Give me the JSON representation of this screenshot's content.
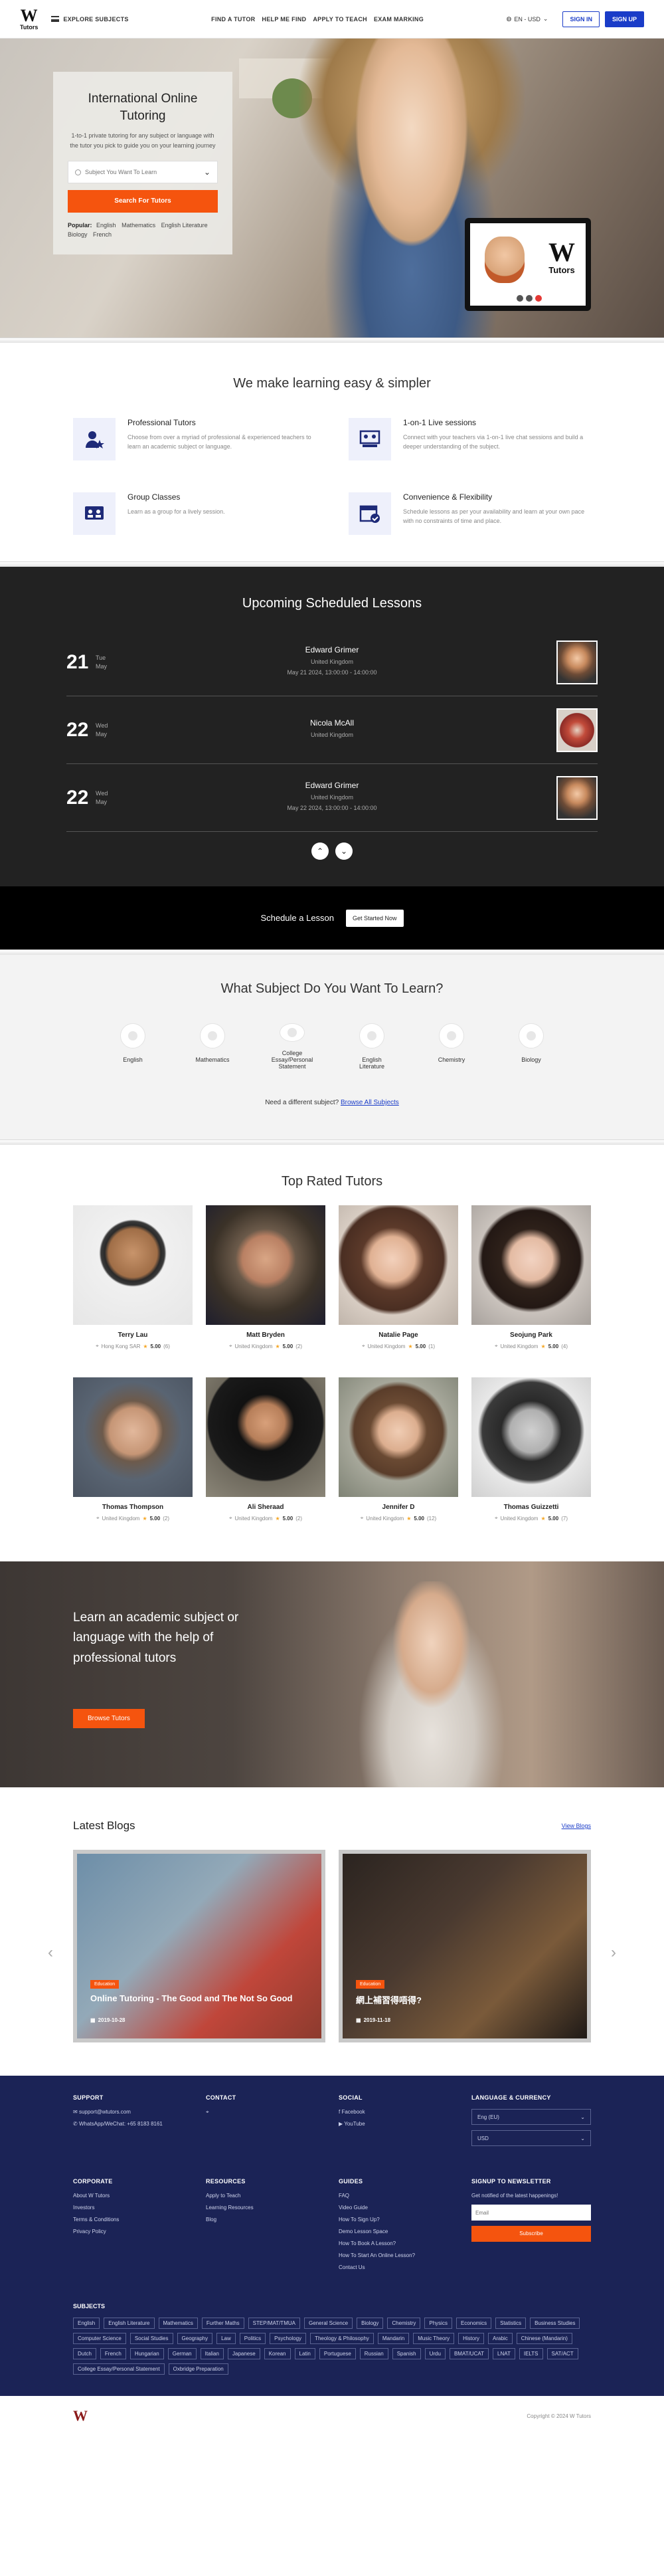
{
  "nav": {
    "logo_letter": "W",
    "logo_text": "Tutors",
    "explore": "EXPLORE SUBJECTS",
    "links": [
      "FIND A TUTOR",
      "HELP ME FIND",
      "APPLY TO TEACH",
      "EXAM MARKING"
    ],
    "lang": "EN - USD",
    "signin": "SIGN IN",
    "signup": "SIGN UP"
  },
  "hero": {
    "title": "International Online Tutoring",
    "subtitle": "1-to-1 private tutoring for any subject or language with the tutor you pick to guide you on your learning journey",
    "search_placeholder": "Subject You Want To Learn",
    "search_button": "Search For Tutors",
    "popular_label": "Popular:",
    "popular": [
      "English",
      "Mathematics",
      "English Literature",
      "Biology",
      "French"
    ],
    "laptop_logo_letter": "W",
    "laptop_logo_text": "Tutors"
  },
  "easy": {
    "title": "We make learning easy & simpler",
    "features": [
      {
        "title": "Professional Tutors",
        "text": "Choose from over a myriad of professional & experienced teachers to learn an academic subject or language.",
        "icon": "tutor-badge-icon"
      },
      {
        "title": "1-on-1 Live sessions",
        "text": "Connect with your teachers via 1-on-1 live chat sessions and build a deeper understanding of the subject.",
        "icon": "live-board-icon"
      },
      {
        "title": "Group Classes",
        "text": "Learn as a group for a lively session.",
        "icon": "group-icon"
      },
      {
        "title": "Convenience & Flexibility",
        "text": "Schedule lessons as per your availability and learn at your own pace with no constraints of time and place.",
        "icon": "calendar-check-icon"
      }
    ]
  },
  "lessons": {
    "title": "Upcoming Scheduled Lessons",
    "items": [
      {
        "day": "21",
        "weekday": "Tue",
        "month": "May",
        "name": "Edward Grimer",
        "country": "United Kingdom",
        "time": "May 21 2024, 13:00:00 - 14:00:00"
      },
      {
        "day": "22",
        "weekday": "Wed",
        "month": "May",
        "name": "Nicola McAll",
        "country": "United Kingdom",
        "time": ""
      },
      {
        "day": "22",
        "weekday": "Wed",
        "month": "May",
        "name": "Edward Grimer",
        "country": "United Kingdom",
        "time": "May 22 2024, 13:00:00 - 14:00:00"
      }
    ]
  },
  "cta": {
    "text": "Schedule a Lesson",
    "button": "Get Started Now"
  },
  "subjects": {
    "title": "What Subject Do You Want To Learn?",
    "items": [
      "English",
      "Mathematics",
      "College Essay/Personal Statement",
      "English Literature",
      "Chemistry",
      "Biology"
    ],
    "need_text": "Need a different subject?",
    "need_link": "Browse All Subjects"
  },
  "tutors": {
    "title": "Top Rated Tutors",
    "items": [
      {
        "name": "Terry Lau",
        "location": "Hong Kong SAR",
        "rating": "5.00",
        "count": "(6)"
      },
      {
        "name": "Matt Bryden",
        "location": "United Kingdom",
        "rating": "5.00",
        "count": "(2)"
      },
      {
        "name": "Natalie Page",
        "location": "United Kingdom",
        "rating": "5.00",
        "count": "(1)"
      },
      {
        "name": "Seojung Park",
        "location": "United Kingdom",
        "rating": "5.00",
        "count": "(4)"
      },
      {
        "name": "Thomas Thompson",
        "location": "United Kingdom",
        "rating": "5.00",
        "count": "(2)"
      },
      {
        "name": "Ali Sheraad",
        "location": "United Kingdom",
        "rating": "5.00",
        "count": "(2)"
      },
      {
        "name": "Jennifer D",
        "location": "United Kingdom",
        "rating": "5.00",
        "count": "(12)"
      },
      {
        "name": "Thomas Guizzetti",
        "location": "United Kingdom",
        "rating": "5.00",
        "count": "(7)"
      }
    ]
  },
  "promo": {
    "text": "Learn an academic subject or language with the help of professional tutors",
    "button": "Browse Tutors"
  },
  "blogs": {
    "title": "Latest Blogs",
    "view": "View Blogs",
    "items": [
      {
        "tag": "Education",
        "title": "Online Tutoring - The Good and The Not So Good",
        "date": "2019-10-28"
      },
      {
        "tag": "Education",
        "title": "網上補習得唔得?",
        "date": "2019-11-18"
      }
    ]
  },
  "footer": {
    "support_title": "SUPPORT",
    "support": [
      "support@wtutors.com",
      "WhatsApp/WeChat: +65 8183 8161"
    ],
    "contact_title": "CONTACT",
    "social_title": "SOCIAL",
    "social": [
      "Facebook",
      "YouTube"
    ],
    "lang_title": "LANGUAGE & CURRENCY",
    "lang_value": "Eng (EU)",
    "currency_value": "USD",
    "corporate_title": "CORPORATE",
    "corporate": [
      "About W Tutors",
      "Investors",
      "Terms & Conditions",
      "Privacy Policy"
    ],
    "resources_title": "RESOURCES",
    "resources": [
      "Apply to Teach",
      "Learning Resources",
      "Blog"
    ],
    "guides_title": "GUIDES",
    "guides": [
      "FAQ",
      "Video Guide",
      "How To Sign Up?",
      "Demo Lesson Space",
      "How To Book A Lesson?",
      "How To Start An Online Lesson?",
      "Contact Us"
    ],
    "newsletter_title": "SIGNUP TO NEWSLETTER",
    "newsletter_text": "Get notified of the latest happenings!",
    "email_placeholder": "Email",
    "subscribe": "Subscribe",
    "subjects_title": "SUBJECTS",
    "subjects": [
      "English",
      "English Literature",
      "Mathematics",
      "Further Maths",
      "STEP/MAT/TMUA",
      "General Science",
      "Biology",
      "Chemistry",
      "Physics",
      "Economics",
      "Statistics",
      "Business Studies",
      "Computer Science",
      "Social Studies",
      "Geography",
      "Law",
      "Politics",
      "Psychology",
      "Theology & Philosophy",
      "Mandarin",
      "Music Theory",
      "History",
      "Arabic",
      "Chinese (Mandarin)",
      "Dutch",
      "French",
      "Hungarian",
      "German",
      "Italian",
      "Japanese",
      "Korean",
      "Latin",
      "Portuguese",
      "Russian",
      "Spanish",
      "Urdu",
      "BMAT/UCAT",
      "LNAT",
      "IELTS",
      "SAT/ACT",
      "College Essay/Personal Statement",
      "Oxbridge Preparation"
    ],
    "copyright": "Copyright © 2024 W Tutors"
  }
}
